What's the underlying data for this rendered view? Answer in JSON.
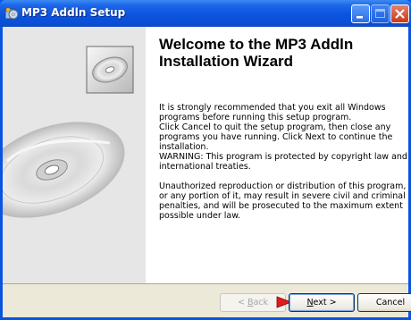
{
  "window": {
    "title": "MP3 Addln Setup",
    "icon": "setup-icon"
  },
  "content": {
    "heading": "Welcome to the MP3 Addln Installation Wizard",
    "paragraph1": "It is strongly recommended that you exit all Windows programs before running this setup program.",
    "paragraph2": "Click Cancel to quit the setup program, then close any programs you have running.  Click Next to continue the installation.",
    "paragraph3": "WARNING: This program is protected by copyright law and international treaties.",
    "paragraph4": "Unauthorized reproduction or distribution of this program, or any portion of it, may result in severe civil and criminal penalties, and will be prosecuted to the maximum extent possible under law."
  },
  "buttons": {
    "back_prefix": "< ",
    "back_key": "B",
    "back_rest": "ack",
    "next_key": "N",
    "next_rest": "ext >",
    "cancel": "Cancel"
  },
  "colors": {
    "titlebar": "#0b54de",
    "sidepanel": "#e6e6e6",
    "buttonbar": "#ece9d8"
  }
}
